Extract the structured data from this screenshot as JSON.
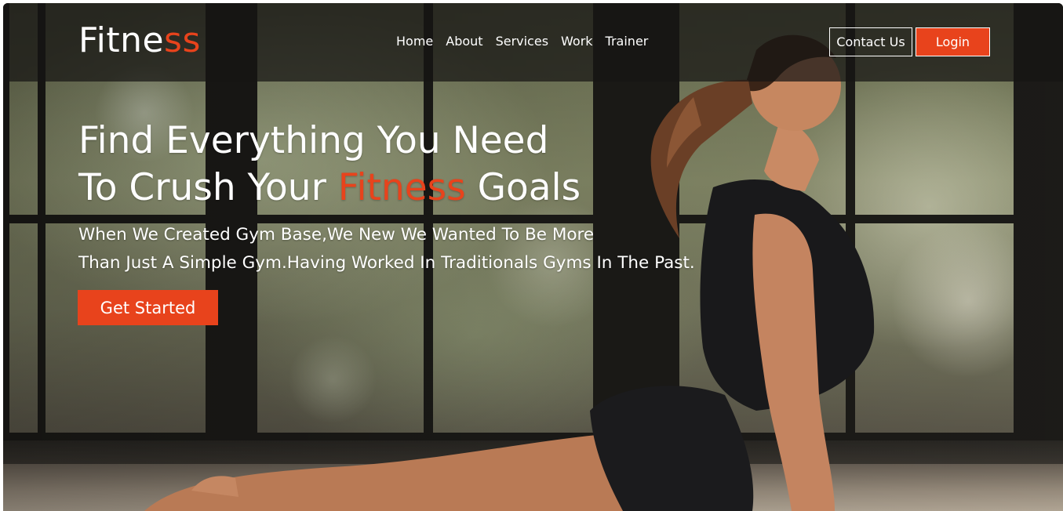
{
  "brand": {
    "name_main": "Fitne",
    "name_accent": "ss"
  },
  "nav": {
    "items": [
      {
        "label": "Home"
      },
      {
        "label": "About"
      },
      {
        "label": "Services"
      },
      {
        "label": "Work"
      },
      {
        "label": "Trainer"
      }
    ]
  },
  "header": {
    "contact_label": "Contact Us",
    "login_label": "Login"
  },
  "hero": {
    "title_line1": "Find Everything You Need",
    "title_line2_prefix": "To Crush Your ",
    "title_line2_accent": "Fitness",
    "title_line2_suffix": " Goals",
    "subtitle_line1": "When We Created Gym Base,We New We Wanted To Be More",
    "subtitle_line2": "Than Just A Simple Gym.Having Worked In Traditionals Gyms In The Past.",
    "cta_label": "Get Started"
  },
  "colors": {
    "accent": "#e8431c",
    "header_bg": "#161513",
    "text": "#ffffff"
  },
  "icons": {
    "hero_image": "yoga-woman-photo"
  }
}
